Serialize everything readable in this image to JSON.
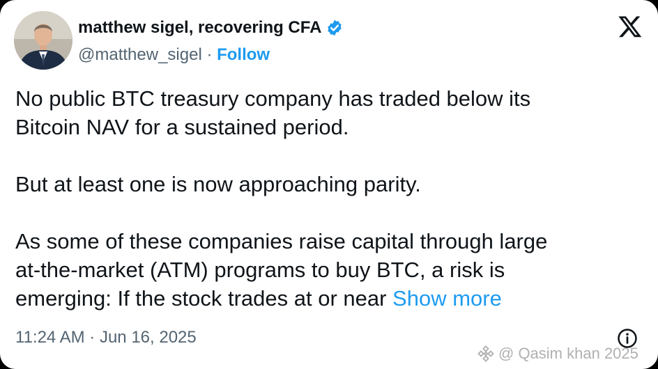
{
  "tweet": {
    "author": {
      "display_name": "matthew sigel, recovering CFA",
      "handle": "@matthew_sigel",
      "separator": " · ",
      "follow_label": "Follow",
      "verified_icon": "verified-badge-icon"
    },
    "logo_icon": "x-logo-icon",
    "text": {
      "line1": "No public BTC treasury company has traded below its",
      "line2": "Bitcoin NAV for a sustained period.",
      "line3": "But at least one is now approaching parity.",
      "line4": "As some of these companies raise capital through large",
      "line5": "at-the-market (ATM) programs to buy BTC, a risk is",
      "line6": "emerging: If the stock trades at or near ",
      "show_more": "Show more"
    },
    "timestamp": "11:24 AM · Jun 16, 2025",
    "info_icon": "info-icon"
  },
  "watermark": {
    "text": "@ Qasim khan 2025"
  },
  "colors": {
    "link": "#1d9bf0",
    "text": "#0f1419",
    "secondary": "#536471"
  }
}
